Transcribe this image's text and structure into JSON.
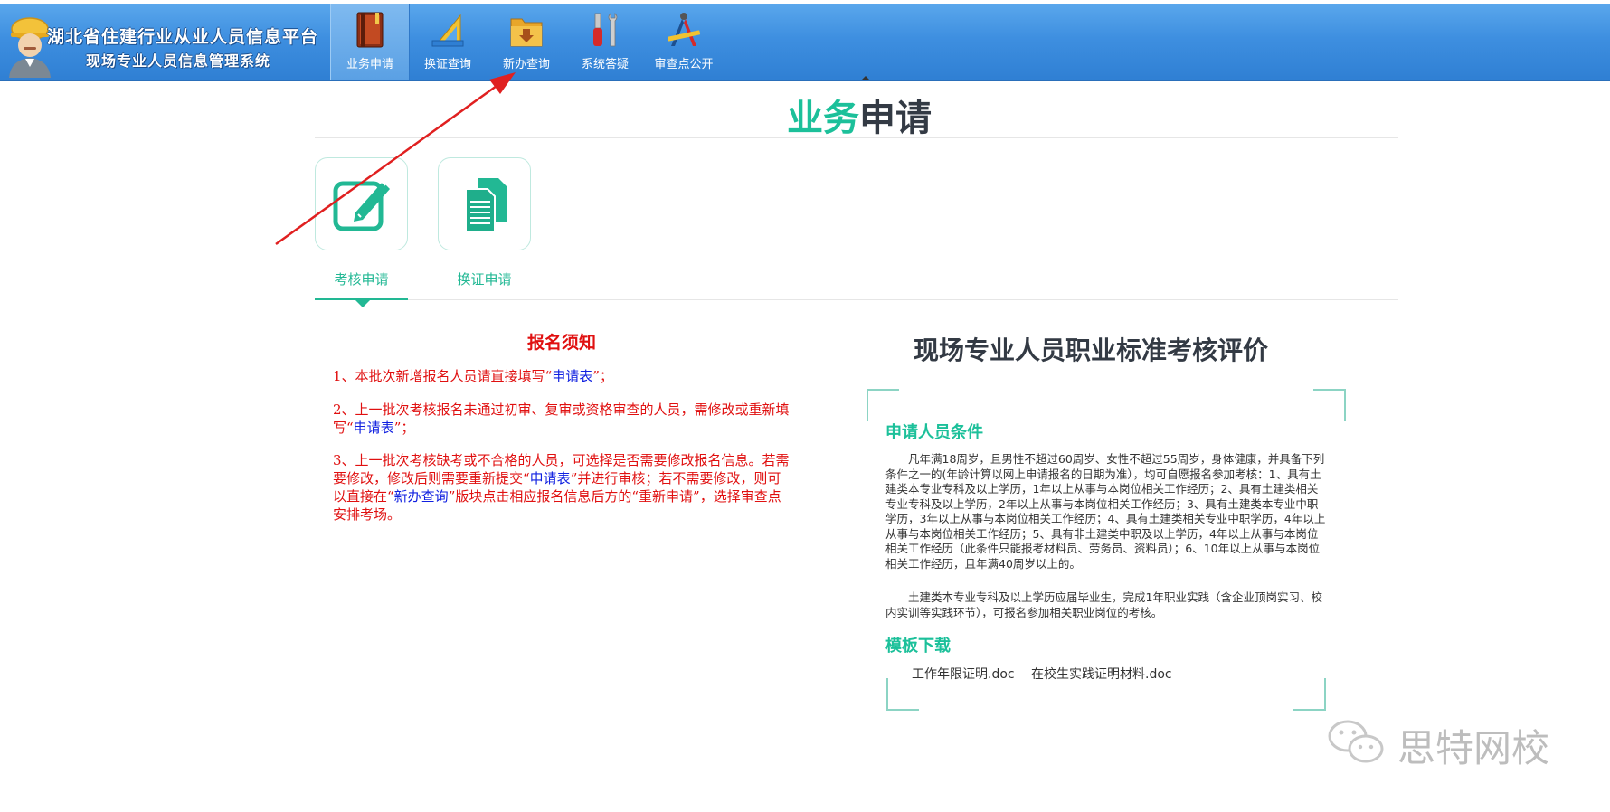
{
  "header": {
    "logo_line1": "湖北省住建行业从业人员信息平台",
    "logo_line2": "现场专业人员信息管理系统",
    "nav": [
      {
        "label": "业务申请",
        "icon": "book-icon",
        "active": true
      },
      {
        "label": "换证查询",
        "icon": "ruler-triangle-icon",
        "active": false
      },
      {
        "label": "新办查询",
        "icon": "folder-download-icon",
        "active": false
      },
      {
        "label": "系统答疑",
        "icon": "tools-icon",
        "active": false
      },
      {
        "label": "审查点公开",
        "icon": "drafting-compass-icon",
        "active": false
      }
    ]
  },
  "page_title": {
    "part1": "业务",
    "part2": "申请"
  },
  "tiles": [
    {
      "label": "考核申请",
      "icon": "edit-pencil-icon",
      "selected": true
    },
    {
      "label": "换证申请",
      "icon": "documents-icon",
      "selected": false
    }
  ],
  "notice": {
    "title": "报名须知",
    "item1": {
      "pre": "1、本批次新增报名人员请直接填写“",
      "link": "申请表",
      "post": "”；"
    },
    "item2": {
      "pre": "2、上一批次考核报名未通过初审、复审或资格审查的人员，需修改或重新填写“",
      "link": "申请表",
      "post": "”；"
    },
    "item3": {
      "pre": "3、上一批次考核缺考或不合格的人员，可选择是否需要修改报名信息。若需要修改，修改后则需要重新提交“",
      "link1": "申请表",
      "mid": "”并进行审核；若不需要修改，则可以直接在“",
      "link2": "新办查询",
      "post": "”版块点击相应报名信息后方的“重新申请”，选择审查点安排考场。"
    }
  },
  "right_panel": {
    "title": "现场专业人员职业标准考核评价",
    "conditions_heading": "申请人员条件",
    "conditions_p1": "凡年满18周岁，且男性不超过60周岁、女性不超过55周岁，身体健康，并具备下列条件之一的(年龄计算以网上申请报名的日期为准），均可自愿报名参加考核：1、具有土建类本专业专科及以上学历，1年以上从事与本岗位相关工作经历；2、具有土建类相关专业专科及以上学历，2年以上从事与本岗位相关工作经历；3、具有土建类本专业中职学历，3年以上从事与本岗位相关工作经历；4、具有土建类相关专业中职学历，4年以上从事与本岗位相关工作经历；5、具有非土建类中职及以上学历，4年以上从事与本岗位相关工作经历（此条件只能报考材料员、劳务员、资料员）；6、10年以上从事与本岗位相关工作经历，且年满40周岁以上的。",
    "conditions_p2": "土建类本专业专科及以上学历应届毕业生，完成1年职业实践（含企业顶岗实习、校内实训等实践环节），可报名参加相关职业岗位的考核。",
    "templates_heading": "模板下载",
    "downloads": [
      "工作年限证明.doc",
      "在校生实践证明材料.doc"
    ]
  },
  "watermark": {
    "text": "思特网校"
  },
  "colors": {
    "accent_green": "#1cc09a",
    "header_blue": "#3e8fe0",
    "notice_red": "#e01010",
    "link_blue": "#1020e0",
    "annotation_arrow": "#e02020"
  }
}
